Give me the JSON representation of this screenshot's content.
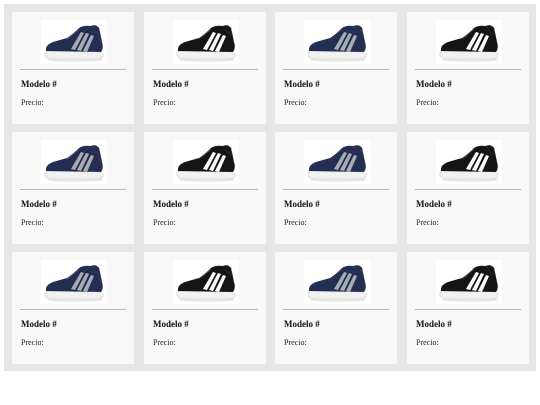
{
  "products": [
    {
      "model_label": "Modelo #",
      "price_label": "Precio:",
      "variant": "navy"
    },
    {
      "model_label": "Modelo #",
      "price_label": "Precio:",
      "variant": "black"
    },
    {
      "model_label": "Modelo #",
      "price_label": "Precio:",
      "variant": "navy"
    },
    {
      "model_label": "Modelo #",
      "price_label": "Precio:",
      "variant": "black"
    },
    {
      "model_label": "Modelo #",
      "price_label": "Precio:",
      "variant": "navy"
    },
    {
      "model_label": "Modelo #",
      "price_label": "Precio:",
      "variant": "black"
    },
    {
      "model_label": "Modelo #",
      "price_label": "Precio:",
      "variant": "navy"
    },
    {
      "model_label": "Modelo #",
      "price_label": "Precio:",
      "variant": "black"
    },
    {
      "model_label": "Modelo #",
      "price_label": "Precio:",
      "variant": "navy"
    },
    {
      "model_label": "Modelo #",
      "price_label": "Precio:",
      "variant": "black"
    },
    {
      "model_label": "Modelo #",
      "price_label": "Precio:",
      "variant": "navy"
    },
    {
      "model_label": "Modelo #",
      "price_label": "Precio:",
      "variant": "black"
    }
  ],
  "colors": {
    "panel_bg": "#e6e6e6",
    "card_bg": "#f8f8f8",
    "navy_upper": "#232e52",
    "black_upper": "#151515",
    "navy_stripes": "#a9adb3",
    "black_stripes": "#ffffff"
  }
}
